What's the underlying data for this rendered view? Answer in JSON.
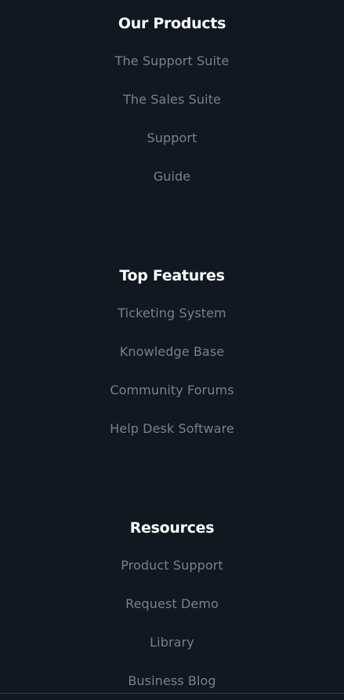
{
  "footer": {
    "sections": [
      {
        "title": "Our Products",
        "links": [
          "The Support Suite",
          "The Sales Suite",
          "Support",
          "Guide"
        ]
      },
      {
        "title": "Top Features",
        "links": [
          "Ticketing System",
          "Knowledge Base",
          "Community Forums",
          "Help Desk Software"
        ]
      },
      {
        "title": "Resources",
        "links": [
          "Product Support",
          "Request Demo",
          "Library",
          "Business Blog"
        ]
      }
    ]
  },
  "colors": {
    "background": "#111820",
    "heading": "#ffffff",
    "link": "#7b8086"
  }
}
